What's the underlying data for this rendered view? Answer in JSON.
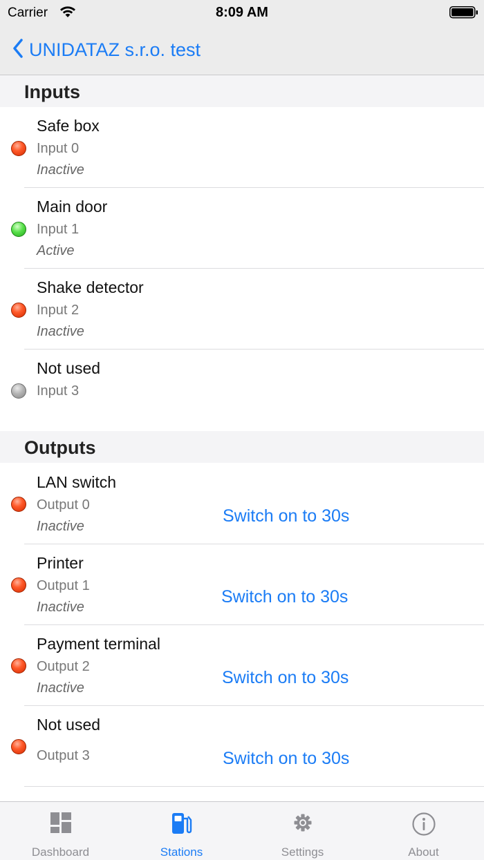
{
  "status_bar": {
    "carrier": "Carrier",
    "time": "8:09 AM"
  },
  "nav": {
    "back_label": "UNIDATAZ s.r.o. test"
  },
  "inputs": {
    "header": "Inputs",
    "items": [
      {
        "name": "Safe box",
        "channel": "Input 0",
        "state": "Inactive",
        "indicator": "red"
      },
      {
        "name": "Main door",
        "channel": "Input 1",
        "state": "Active",
        "indicator": "green"
      },
      {
        "name": "Shake detector",
        "channel": "Input 2",
        "state": "Inactive",
        "indicator": "red"
      },
      {
        "name": "Not used",
        "channel": "Input 3",
        "state": "",
        "indicator": "gray"
      }
    ]
  },
  "outputs": {
    "header": "Outputs",
    "items": [
      {
        "name": "LAN switch",
        "channel": "Output 0",
        "state": "Inactive",
        "indicator": "red",
        "action": "Switch on to 30s"
      },
      {
        "name": "Printer",
        "channel": "Output 1",
        "state": "Inactive",
        "indicator": "red",
        "action": "Switch on to 30s"
      },
      {
        "name": "Payment terminal",
        "channel": "Output 2",
        "state": "Inactive",
        "indicator": "red",
        "action": "Switch on to 30s"
      },
      {
        "name": "Not used",
        "channel": "Output 3",
        "state": "",
        "indicator": "red",
        "action": "Switch on to 30s"
      }
    ]
  },
  "tabs": [
    {
      "label": "Dashboard",
      "icon": "dashboard-icon",
      "active": false
    },
    {
      "label": "Stations",
      "icon": "fuel-station-icon",
      "active": true
    },
    {
      "label": "Settings",
      "icon": "gear-icon",
      "active": false
    },
    {
      "label": "About",
      "icon": "info-icon",
      "active": false
    }
  ],
  "colors": {
    "accent": "#1b7cf5",
    "inactive_indicator": "#ff5a2a",
    "active_indicator": "#58e04a",
    "unused_indicator": "#b4b4b4"
  }
}
